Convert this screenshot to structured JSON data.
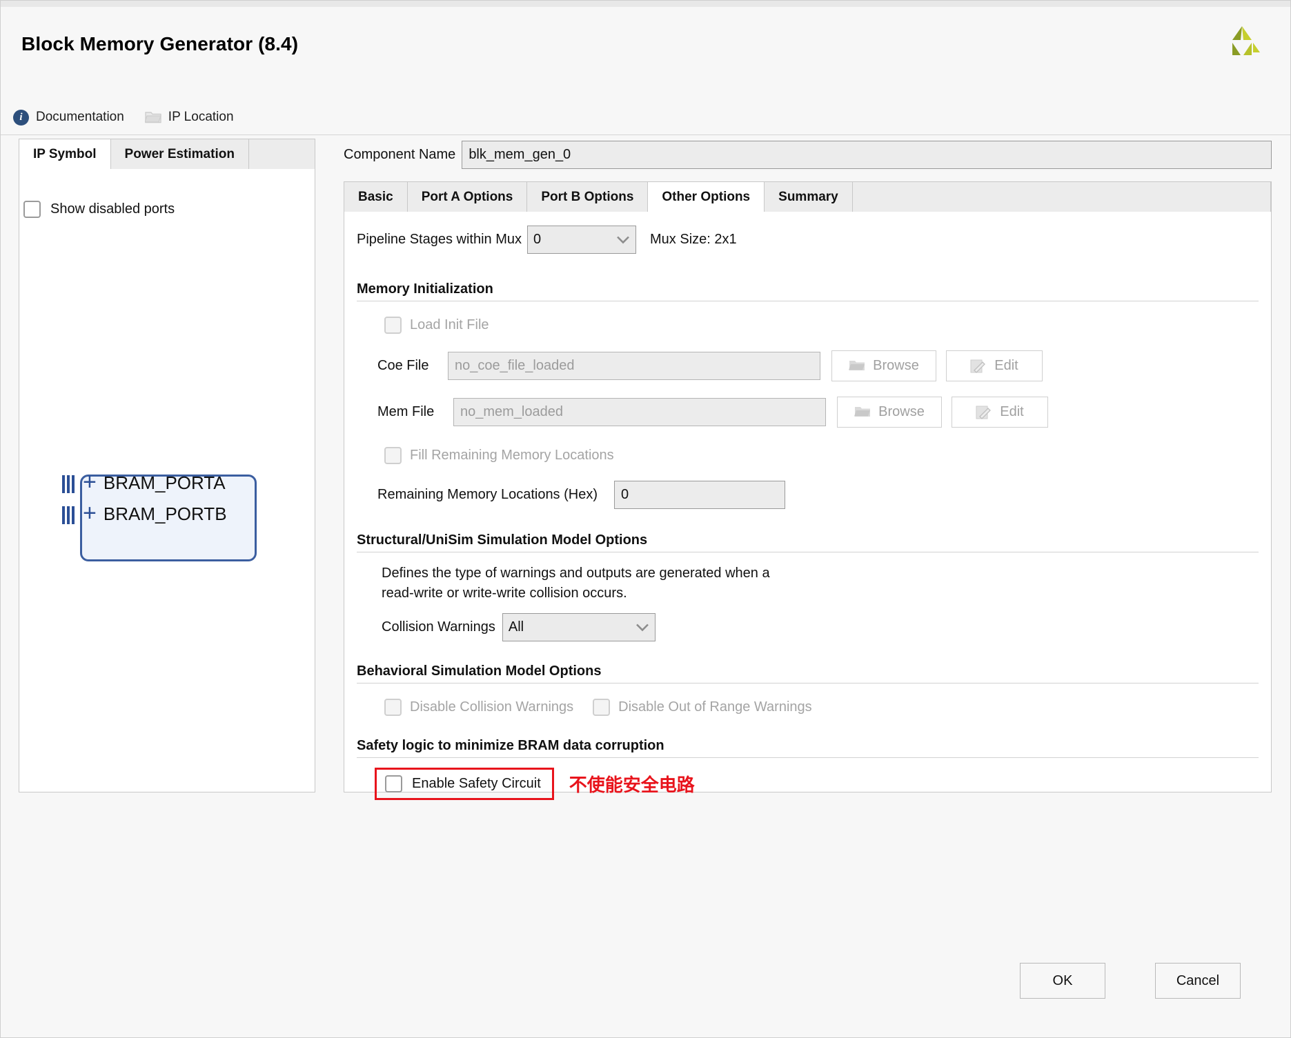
{
  "window": {
    "title": "Block Memory Generator (8.4)"
  },
  "actionbar": {
    "documentation": "Documentation",
    "ip_location": "IP Location"
  },
  "left_panel": {
    "tabs": [
      {
        "label": "IP Symbol",
        "active": true
      },
      {
        "label": "Power Estimation",
        "active": false
      }
    ],
    "show_disabled_ports": "Show disabled ports",
    "symbol": {
      "ports": [
        "BRAM_PORTA",
        "BRAM_PORTB"
      ],
      "box_color": "#3b5ea0",
      "box_fill": "#eef3fb"
    }
  },
  "component": {
    "label": "Component Name",
    "value": "blk_mem_gen_0"
  },
  "tabs": [
    {
      "label": "Basic",
      "active": false
    },
    {
      "label": "Port A Options",
      "active": false
    },
    {
      "label": "Port B Options",
      "active": false
    },
    {
      "label": "Other Options",
      "active": true
    },
    {
      "label": "Summary",
      "active": false
    }
  ],
  "other_options": {
    "pipeline": {
      "label": "Pipeline Stages within Mux",
      "value": "0",
      "mux_size": "Mux Size: 2x1"
    },
    "memory_init": {
      "section": "Memory Initialization",
      "load_init_file": "Load Init File",
      "coe_file": {
        "label": "Coe File",
        "value": "no_coe_file_loaded",
        "browse": "Browse",
        "edit": "Edit"
      },
      "mem_file": {
        "label": "Mem File",
        "value": "no_mem_loaded",
        "browse": "Browse",
        "edit": "Edit"
      },
      "fill_remaining": "Fill Remaining Memory Locations",
      "remaining_label": "Remaining Memory Locations (Hex)",
      "remaining_value": "0"
    },
    "structural": {
      "section": "Structural/UniSim Simulation Model Options",
      "desc_line1": "Defines the type of warnings and outputs are generated when a",
      "desc_line2": "read-write or write-write collision occurs.",
      "collision_label": "Collision Warnings",
      "collision_value": "All"
    },
    "behavioral": {
      "section": "Behavioral Simulation Model Options",
      "disable_collision": "Disable Collision Warnings",
      "disable_out_of_range": "Disable Out of Range Warnings"
    },
    "safety": {
      "section": "Safety logic to minimize BRAM data corruption",
      "enable_safety_circuit": "Enable Safety Circuit",
      "annotation": "不使能安全电路",
      "annotation_color": "#e8141c"
    }
  },
  "footer": {
    "ok": "OK",
    "cancel": "Cancel"
  }
}
